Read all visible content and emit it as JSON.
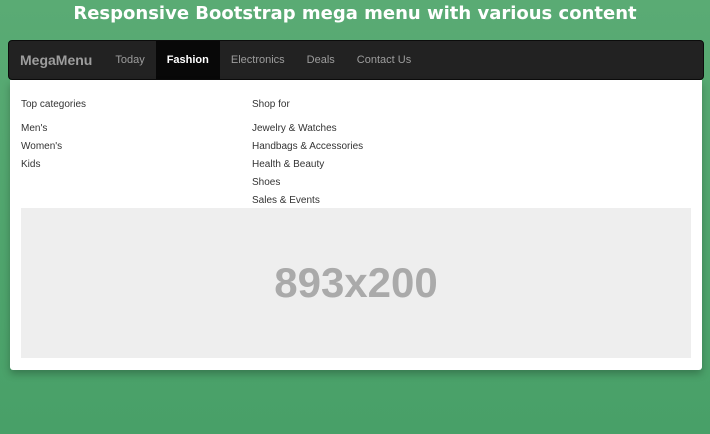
{
  "page": {
    "heading": "Responsive Bootstrap mega menu with various content"
  },
  "navbar": {
    "brand": "MegaMenu",
    "items": [
      {
        "label": "Today",
        "active": false
      },
      {
        "label": "Fashion",
        "active": true
      },
      {
        "label": "Electronics",
        "active": false
      },
      {
        "label": "Deals",
        "active": false
      },
      {
        "label": "Contact Us",
        "active": false
      }
    ]
  },
  "dropdown": {
    "top_categories": {
      "heading": "Top categories",
      "links": [
        "Men's",
        "Women's",
        "Kids"
      ]
    },
    "shop_for": {
      "heading": "Shop for",
      "links": [
        "Jewelry & Watches",
        "Handbags & Accessories",
        "Health & Beauty",
        "Shoes",
        "Sales & Events"
      ]
    },
    "image_placeholder": "893x200"
  },
  "colors": {
    "background": "#4fa36d",
    "navbar": "#222222",
    "active_item": "#080808",
    "placeholder_bg": "#eeeeee",
    "placeholder_text": "#aaaaaa"
  }
}
